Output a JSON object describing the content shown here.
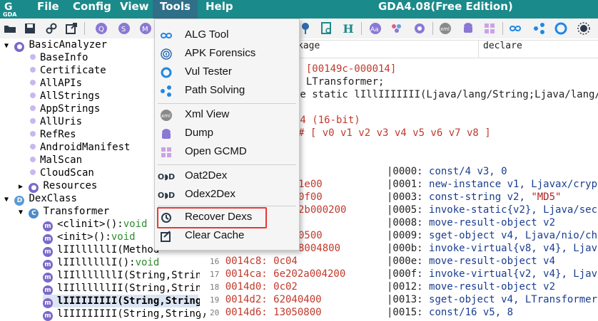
{
  "app": {
    "title": "GDA4.08(Free Edition)",
    "logo_text": "GDA"
  },
  "menubar": [
    {
      "label": "File"
    },
    {
      "label": "Config"
    },
    {
      "label": "View"
    },
    {
      "label": "Tools"
    },
    {
      "label": "Help"
    }
  ],
  "tools_menu": {
    "items": [
      {
        "label": "ALG Tool",
        "icon": "infinity-icon"
      },
      {
        "label": "APK Forensics",
        "icon": "fingerprint-icon"
      },
      {
        "label": "Vul Tester",
        "icon": "ring-icon"
      },
      {
        "label": "Path Solving",
        "icon": "graph-nodes-icon"
      },
      {
        "label": "Xml View",
        "icon": "xml-icon"
      },
      {
        "label": "Dump",
        "icon": "android-icon"
      },
      {
        "label": "Open GCMD",
        "icon": "windows-icon"
      },
      {
        "label": "Oat2Dex",
        "icon": "oat-icon"
      },
      {
        "label": "Odex2Dex",
        "icon": "odex-icon"
      },
      {
        "label": "Recover Dexs",
        "icon": "recover-icon"
      },
      {
        "label": "Clear Cache",
        "icon": "clear-cache-icon"
      }
    ]
  },
  "tree": {
    "root": "BasicAnalyzer",
    "basic_items": [
      "BaseInfo",
      "Certificate",
      "AllAPIs",
      "AllStrings",
      "AppStrings",
      "AllUris",
      "RefRes",
      "AndroidManifest",
      "MalScan",
      "CloudScan"
    ],
    "resources": "Resources",
    "dexclass": "DexClass",
    "transformer": "Transformer",
    "methods": [
      {
        "name": "<clinit>():",
        "ret": "void"
      },
      {
        "name": "<init>():",
        "ret": "void"
      },
      {
        "name": "lIIllllllI(Method",
        "ret": ""
      },
      {
        "name": "lIIllllllI():",
        "ret": "void"
      },
      {
        "name": "lIIlllllllI(String,String)",
        "ret": ""
      },
      {
        "name": "lIIllllllII(String,String)",
        "ret": ""
      },
      {
        "name": "lIIIIIIIII(String,String)",
        "ret": ""
      },
      {
        "name": "lIIIIIIIII(String,String)",
        "ret": ""
      }
    ]
  },
  "panel": {
    "field1": "kage",
    "field2": "declare",
    "header_lines": [
      "n [00149c-000014]",
      ": LTransformer;",
      "te static lIllIIIIIII(Ljava/lang/String;Ljava/lang/St",
      "54 (16-bit)",
      "# [ v0  v1  v2  v3  v4  v5  v6  v7  v8  ]"
    ],
    "hex_frag": [
      "1e00",
      "0f00",
      "2b000200",
      "0500",
      "8004800"
    ],
    "hex_rows": [
      {
        "ln": "16",
        "addr": "0014c8:",
        "hex": "0c04"
      },
      {
        "ln": "17",
        "addr": "0014ca:",
        "hex": "6e202a004200"
      },
      {
        "ln": "18",
        "addr": "0014d0:",
        "hex": "0c02"
      },
      {
        "ln": "19",
        "addr": "0014d2:",
        "hex": "62040400"
      },
      {
        "ln": "20",
        "addr": "0014d6:",
        "hex": "13050800"
      }
    ],
    "code": [
      {
        "off": "|0000:",
        "ins": "const/4 v3, 0"
      },
      {
        "off": "|0001:",
        "ins": "new-instance v1, Ljavax/crypto"
      },
      {
        "off": "|0003:",
        "ins": "const-string v2, ",
        "str": "\"MD5\""
      },
      {
        "off": "|0005:",
        "ins": "invoke-static{v2}, Ljava/secur"
      },
      {
        "off": "|0008:",
        "ins": "move-result-object v2"
      },
      {
        "off": "|0009:",
        "ins": "sget-object v4, Ljava/nio/char"
      },
      {
        "off": "|000b:",
        "ins": "invoke-virtual{v8, v4}, Ljava/"
      },
      {
        "off": "|000e:",
        "ins": "move-result-object v4"
      },
      {
        "off": "|000f:",
        "ins": "invoke-virtual{v2, v4}, Ljava/"
      },
      {
        "off": "|0012:",
        "ins": "move-result-object v2"
      },
      {
        "off": "|0013:",
        "ins": "sget-object v4, LTransformer;-"
      },
      {
        "off": "|0015:",
        "ins": "const/16 v5, 8"
      }
    ]
  },
  "colors": {
    "titlebar": "#1b8a8a",
    "highlight": "#e53935",
    "accent": "#7b69c9"
  }
}
